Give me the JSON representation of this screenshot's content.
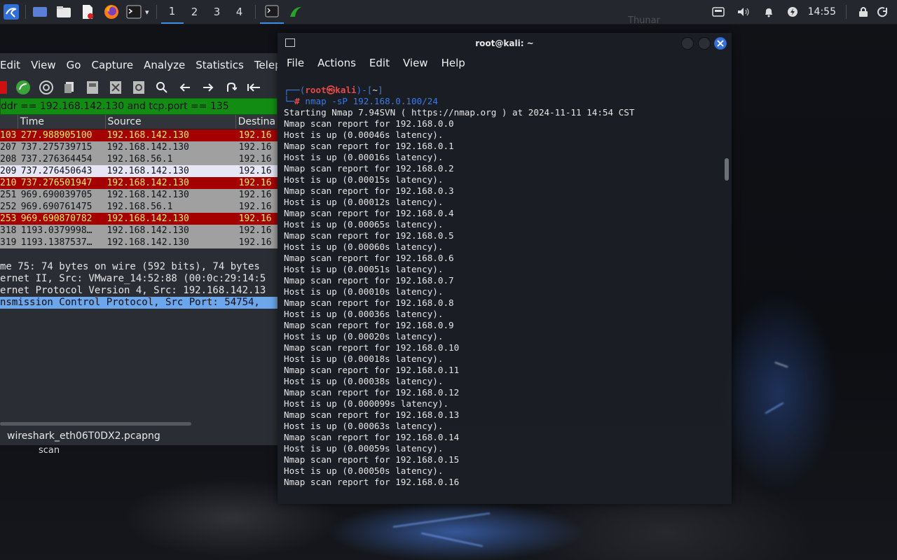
{
  "taskbar": {
    "workspaces": [
      "1",
      "2",
      "3",
      "4"
    ],
    "active_workspace": "1",
    "clock": "14:55",
    "icons": [
      "kali-menu-icon",
      "show-desktop-icon",
      "file-manager-icon",
      "text-editor-icon",
      "firefox-icon",
      "terminal-icon"
    ]
  },
  "wireshark": {
    "menu": [
      "Edit",
      "View",
      "Go",
      "Capture",
      "Analyze",
      "Statistics",
      "Telephony"
    ],
    "filter": "ddr == 192.168.142.130 and tcp.port == 135",
    "columns": [
      "Time",
      "Source",
      "Destina"
    ],
    "rows": [
      {
        "no": "103",
        "time": "277.988905100",
        "source": "192.168.142.130",
        "dest": "192.16",
        "style": "red"
      },
      {
        "no": "207",
        "time": "737.275739715",
        "source": "192.168.142.130",
        "dest": "192.16",
        "style": "gray"
      },
      {
        "no": "208",
        "time": "737.276364454",
        "source": "192.168.56.1",
        "dest": "192.16",
        "style": "gray"
      },
      {
        "no": "209",
        "time": "737.276450643",
        "source": "192.168.142.130",
        "dest": "192.16",
        "style": "sel"
      },
      {
        "no": "210",
        "time": "737.276501947",
        "source": "192.168.142.130",
        "dest": "192.16",
        "style": "red"
      },
      {
        "no": "251",
        "time": "969.690039705",
        "source": "192.168.142.130",
        "dest": "192.16",
        "style": "gray"
      },
      {
        "no": "252",
        "time": "969.690761475",
        "source": "192.168.56.1",
        "dest": "192.16",
        "style": "gray"
      },
      {
        "no": "253",
        "time": "969.690870782",
        "source": "192.168.142.130",
        "dest": "192.16",
        "style": "red"
      },
      {
        "no": "318",
        "time": "1193.0379998…",
        "source": "192.168.142.130",
        "dest": "192.16",
        "style": "gray"
      },
      {
        "no": "319",
        "time": "1193.1387537…",
        "source": "192.168.142.130",
        "dest": "192.16",
        "style": "gray"
      }
    ],
    "details": [
      "me 75: 74 bytes on wire (592 bits), 74 bytes",
      "ernet II, Src: VMware_14:52:88 (00:0c:29:14:5",
      "ernet Protocol Version 4, Src: 192.168.142.13",
      "nsmission Control Protocol, Src Port: 54754,"
    ],
    "status_file": "wireshark_eth06T0DX2.pcapng"
  },
  "desktop": {
    "icon_label": "scan"
  },
  "terminal": {
    "title": "root@kali: ~",
    "menu": [
      "File",
      "Actions",
      "Edit",
      "View",
      "Help"
    ],
    "prompt_user": "root",
    "prompt_at": "㉿",
    "prompt_host": "kali",
    "prompt_dir": "~",
    "command": "nmap -sP 192.168.0.100/24",
    "output": [
      "Starting Nmap 7.94SVN ( https://nmap.org ) at 2024-11-11 14:54 CST",
      "Nmap scan report for 192.168.0.0",
      "Host is up (0.00046s latency).",
      "Nmap scan report for 192.168.0.1",
      "Host is up (0.00016s latency).",
      "Nmap scan report for 192.168.0.2",
      "Host is up (0.00015s latency).",
      "Nmap scan report for 192.168.0.3",
      "Host is up (0.00012s latency).",
      "Nmap scan report for 192.168.0.4",
      "Host is up (0.00065s latency).",
      "Nmap scan report for 192.168.0.5",
      "Host is up (0.00060s latency).",
      "Nmap scan report for 192.168.0.6",
      "Host is up (0.00051s latency).",
      "Nmap scan report for 192.168.0.7",
      "Host is up (0.00010s latency).",
      "Nmap scan report for 192.168.0.8",
      "Host is up (0.00036s latency).",
      "Nmap scan report for 192.168.0.9",
      "Host is up (0.00020s latency).",
      "Nmap scan report for 192.168.0.10",
      "Host is up (0.00018s latency).",
      "Nmap scan report for 192.168.0.11",
      "Host is up (0.00038s latency).",
      "Nmap scan report for 192.168.0.12",
      "Host is up (0.000099s latency).",
      "Nmap scan report for 192.168.0.13",
      "Host is up (0.00063s latency).",
      "Nmap scan report for 192.168.0.14",
      "Host is up (0.00059s latency).",
      "Nmap scan report for 192.168.0.15",
      "Host is up (0.00050s latency).",
      "Nmap scan report for 192.168.0.16"
    ]
  },
  "colors": {
    "accent": "#3a8ee6",
    "filter_green": "#138c13",
    "packet_red": "#a40000",
    "packet_gray": "#a0a0a0",
    "prompt_blue": "#3b7be0",
    "prompt_red": "#e34b4b"
  }
}
